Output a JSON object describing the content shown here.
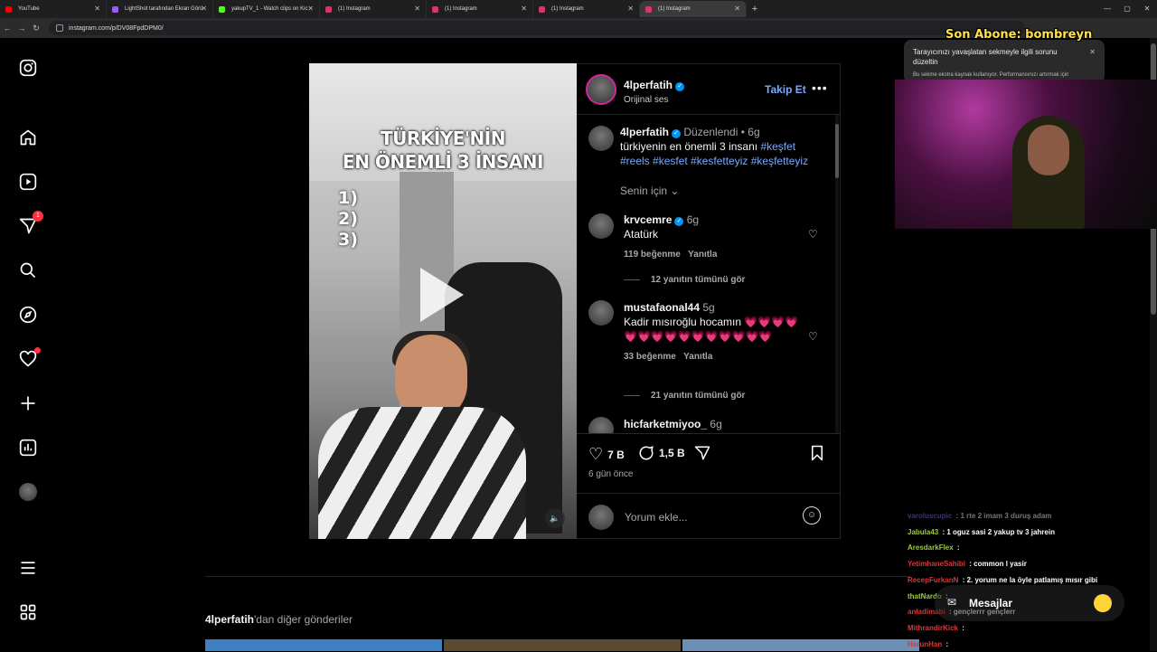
{
  "browser": {
    "tabs": [
      {
        "title": "YouTube",
        "color": "#ff0000"
      },
      {
        "title": "LightShot tarafından Ekran Görü",
        "color": "#9b59ff"
      },
      {
        "title": "yakupTV_1 - Watch clips on Kic",
        "color": "#53fc18"
      },
      {
        "title": "(1) Instagram",
        "color": "#e1306c"
      },
      {
        "title": "(1) Instagram",
        "color": "#e1306c"
      },
      {
        "title": "(1) Instagram",
        "color": "#e1306c"
      },
      {
        "title": "(1) Instagram",
        "color": "#e1306c",
        "active": true
      }
    ],
    "url": "instagram.com/p/DV08FpdDPM0/"
  },
  "nav": {
    "messages_badge": "1"
  },
  "video": {
    "overlay_title_line1": "TÜRKİYE'NİN",
    "overlay_title_line2": "EN ÖNEMLİ 3 İNSANI",
    "list_1": "1)",
    "list_2": "2)",
    "list_3": "3)"
  },
  "post": {
    "username": "4lperfatih",
    "audio": "Orijinal ses",
    "follow_label": "Takip Et",
    "caption_edited": "Düzenlendi",
    "caption_time": "6g",
    "caption_text": "türkiyenin en önemli 3 insanı",
    "caption_tags_1": "#keşfet",
    "caption_tags_2": "#reels #kesfet #kesfetteyiz #keşfetteyiz",
    "for_you": "Senin için",
    "likes": "7 B",
    "comments_count": "1,5 B",
    "posted": "6 gün önce",
    "add_comment_placeholder": "Yorum ekle..."
  },
  "comments": [
    {
      "user": "krvcemre",
      "time": "6g",
      "text": "Atatürk",
      "likes": "119 beğenme",
      "reply": "Yanıtla",
      "view_replies": "12 yanıtın tümünü gör"
    },
    {
      "user": "mustafaonal44",
      "time": "5g",
      "text": "Kadir mısıroğlu hocamın 💗💗💗💗💗💗💗💗💗💗💗💗💗💗💗",
      "likes": "33 beğenme",
      "reply": "Yanıtla",
      "view_replies": "21 yanıtın tümünü gör"
    },
    {
      "user": "hicfarketmiyoo_",
      "time": "6g"
    }
  ],
  "more_posts": {
    "user": "4lperfatih",
    "suffix": "'dan diğer gönderiler"
  },
  "stream": {
    "sub_alert": "Son Abone: bombreyn",
    "popup_title": "Tarayıcınızı yavaşlatan sekmeyle ilgili sorunu düzeltin",
    "popup_small": "Bu sekme ekstra kaynak kullanıyor. Performansınızı artırmak için",
    "chat": [
      {
        "user": "varoluscupic",
        "msg": "1 rte 2 imam 3 duruş adam",
        "color": "#7a7aff",
        "faded": true
      },
      {
        "user": "Jabula43",
        "msg": "1 oguz sasi 2 yakup tv 3 jahrein",
        "color": "#9acd32"
      },
      {
        "user": "AresdarkFlex",
        "msg": "",
        "color": "#9acd32"
      },
      {
        "user": "YetimhaneSahibi",
        "msg": "common l yasir",
        "color": "#d63a3a"
      },
      {
        "user": "RecepFurkanN",
        "msg": "2. yorum ne la öyle patlamış mısır gibi",
        "color": "#d63a3a"
      },
      {
        "user": "thatNardo",
        "msg": "",
        "color": "#9acd32"
      },
      {
        "user": "anladimabi",
        "msg": "gençlerrr gençlerr",
        "color": "#d63a3a"
      },
      {
        "user": "MithrandirKick",
        "msg": "",
        "color": "#d63a3a"
      },
      {
        "user": "HarunHan",
        "msg": "",
        "color": "#d63a3a"
      }
    ],
    "messages_label": "Mesajlar"
  }
}
